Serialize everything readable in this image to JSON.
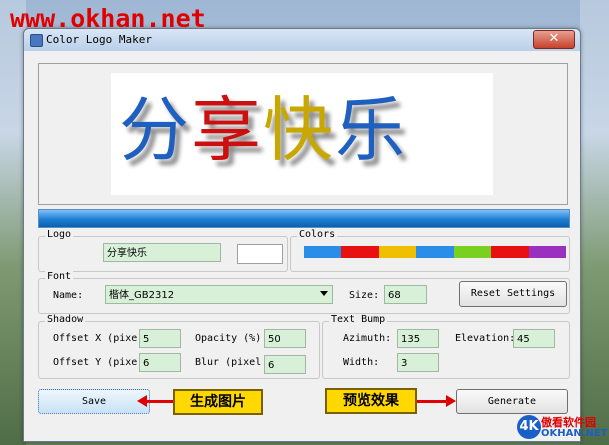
{
  "watermark": "www.okhan.net",
  "window": {
    "title": "Color Logo Maker",
    "close_glyph": "✕"
  },
  "preview": {
    "chars": [
      {
        "char": "分",
        "color": "#1f5fc0"
      },
      {
        "char": "享",
        "color": "#cc1010"
      },
      {
        "char": "快",
        "color": "#c8a800"
      },
      {
        "char": "乐",
        "color": "#1f5fc0"
      }
    ]
  },
  "logo": {
    "group_label": "Logo",
    "text_value": "分享快乐"
  },
  "colors": {
    "group_label": "Colors",
    "swatches": [
      "#2a8ee8",
      "#e81010",
      "#f0c000",
      "#2a8ee8",
      "#7ad020",
      "#e81010",
      "#9a30c0"
    ]
  },
  "font": {
    "group_label": "Font",
    "name_label": "Name:",
    "name_value": "楷体_GB2312",
    "size_label": "Size:",
    "size_value": "68",
    "reset_label": "Reset Settings"
  },
  "shadow": {
    "group_label": "Shadow",
    "offset_x_label": "Offset X (pixe",
    "offset_x_value": "5",
    "offset_y_label": "Offset Y (pixe",
    "offset_y_value": "6",
    "opacity_label": "Opacity (%)",
    "opacity_value": "50",
    "blur_label": "Blur (pixel",
    "blur_value": "6"
  },
  "text_bump": {
    "group_label": "Text Bump",
    "azimuth_label": "Azimuth:",
    "azimuth_value": "135",
    "elevation_label": "Elevation:",
    "elevation_value": "45",
    "width_label": "Width:",
    "width_value": "3"
  },
  "buttons": {
    "save": "Save",
    "generate": "Generate"
  },
  "annotations": {
    "save_callout": "生成图片",
    "generate_callout": "预览效果"
  },
  "corner_logo": {
    "mark": "4K",
    "name_cn": "傲看软件园",
    "name_en": "OKHAN.NET"
  }
}
